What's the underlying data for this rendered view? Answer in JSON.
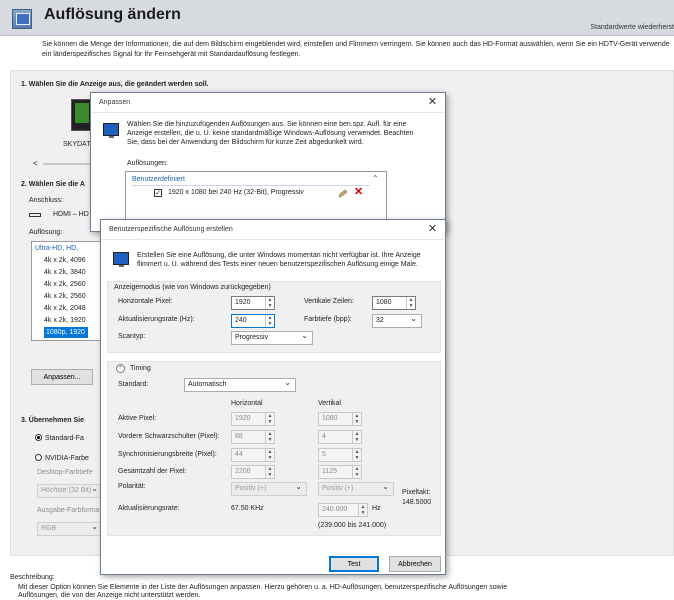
{
  "header": {
    "title": "Auflösung ändern",
    "restore_defaults": "Standardwerte wiederherst",
    "description": "Sie können die Menge der Informationen, die auf dem Bildschirm eingeblendet wird, einstellen und Flimmern verringern. Sie können auch das HD-Format auswählen, wenn Sie ein HDTV-Gerät verwende ein länderspezifisches Signal für Ihr Fernsehgerät mit Standardauflösung festlegen."
  },
  "section1": {
    "heading": "1. Wählen Sie die Anzeige aus, die geändert werden soll.",
    "display_label": "SKYDAT",
    "scroll_left": "<"
  },
  "section2": {
    "heading": "2. Wählen Sie die A",
    "connector_label": "Anschluss:",
    "connector_value": "HDMI – HD",
    "resolution_label": "Auflösung:",
    "resolutions": [
      "Ultra-HD, HD,",
      "4k x 2k, 4096",
      "4k x 2k, 3840",
      "4k x 2k, 2560",
      "4k x 2k, 2560",
      "4k x 2k, 2048",
      "4k x 2k, 1920",
      "1080p, 1920"
    ],
    "customize_button": "Anpassen..."
  },
  "section3": {
    "heading": "3. Übernehmen Sie",
    "option_standard": "Standard-Fa",
    "option_nvidia": "NVIDIA-Farbe",
    "desktop_color_label": "Desktop-Farbtiefe",
    "desktop_color_value": "Höchste (32 Bit)",
    "output_color_label": "Ausgabe-Farbforma",
    "output_color_value": "RGB"
  },
  "footer": {
    "desc_label": "Beschreibung:",
    "desc_text": "Mit dieser Option können Sie Elemente in der Liste der Auflösungen anpassen. Hierzu gehören u. a. HD-Auflösungen, benutzerspezifische Auflösungen sowie Auflösungen, die von der Anzeige nicht unterstützt werden."
  },
  "customize_dialog": {
    "title": "Anpassen",
    "close": "✕",
    "info": "Wählen Sie die hinzuzufügenden Auflösungen aus. Sie können eine ben.spz. Aufl. für eine Anzeige erstellen, die u. U. keine standardmäßige Windows-Auflösung verwendet. Beachten Sie, dass bei der Anwendung der Bildschirm für kurze Zeit abgedunkelt wird.",
    "resolutions_label": "Auflösungen:",
    "group_label": "Benutzerdefiniert",
    "collapse": "⌃",
    "item": "1920 x 1080 bei 240 Hz (32-Bit), Progressiv",
    "item_checked": "✓"
  },
  "create_dialog": {
    "title": "Benutzerspezifische Auflösung erstellen",
    "close": "✕",
    "info": "Erstellen Sie eine Auflösung, die unter Windows momentan nicht verfügbar ist. Ihre Anzeige flimmert u. U. während des Tests einer neuen benutzerspezifischen Auflösung einige Male.",
    "display_mode_legend": "Anzeigemodus (wie von Windows zurückgegeben)",
    "h_pixels_label": "Horizontale Pixel:",
    "h_pixels": "1920",
    "v_lines_label": "Vertikale Zeilen:",
    "v_lines": "1080",
    "refresh_label": "Aktualisierungsrate (Hz):",
    "refresh": "240",
    "color_depth_label": "Farbtiefe (bpp):",
    "color_depth": "32",
    "scan_label": "Scantyp:",
    "scan": "Progressiv",
    "timing_label": "Timing",
    "timing_toggle": "⌃",
    "standard_label": "Standard:",
    "standard": "Automatisch",
    "col_horizontal": "Horizontal",
    "col_vertical": "Vertikal",
    "rows": [
      {
        "label": "Aktive Pixel:",
        "h": "1920",
        "v": "1080"
      },
      {
        "label": "Vordere Schwarzschulter (Pixel):",
        "h": "88",
        "v": "4"
      },
      {
        "label": "Synchronisierungsbreite (Pixel):",
        "h": "44",
        "v": "5"
      },
      {
        "label": "Gesamtzahl der Pixel:",
        "h": "2200",
        "v": "1125"
      }
    ],
    "polarity_label": "Polarität:",
    "polarity_h": "Positiv (+)",
    "polarity_v": "Positiv (+)",
    "rate_label": "Aktualisierungsrate:",
    "rate_h": "67.50 KHz",
    "rate_v": "240.000",
    "rate_v_unit": "Hz",
    "rate_range": "(239.000 bis 241.000)",
    "pixel_clock_label": "Pixeltakt:",
    "pixel_clock": "148.5000",
    "test_button": "Test",
    "cancel_button": "Abbrechen"
  }
}
